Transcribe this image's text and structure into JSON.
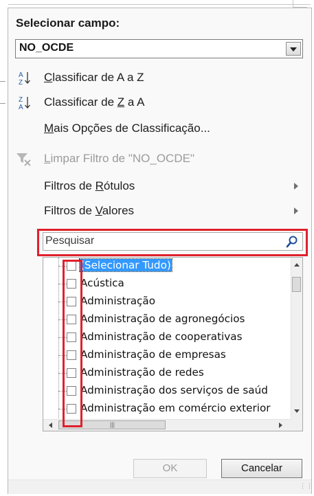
{
  "field_selector": {
    "label": "Selecionar campo:",
    "value": "NO_OCDE"
  },
  "menu": {
    "sort_asc": {
      "pre": "",
      "ul": "C",
      "post": "lassificar de A a Z"
    },
    "sort_desc": {
      "pre": "Classificar de ",
      "ul": "Z",
      "post": " a A"
    },
    "more_sort": {
      "pre": "",
      "ul": "M",
      "post": "ais Opções de Classificação..."
    },
    "clear_filter": {
      "pre": "",
      "ul": "L",
      "post": "impar Filtro de \"NO_OCDE\""
    },
    "label_filters": {
      "pre": "Filtros de ",
      "ul": "R",
      "post": "ótulos"
    },
    "value_filters": {
      "pre": "Filtros de ",
      "ul": "V",
      "post": "alores"
    }
  },
  "search": {
    "placeholder": "Pesquisar"
  },
  "list": {
    "items": [
      {
        "label": "(Selecionar Tudo)",
        "checked": false,
        "selected": true
      },
      {
        "label": "Acústica",
        "checked": false
      },
      {
        "label": "Administração",
        "checked": false
      },
      {
        "label": "Administração de agronegócios",
        "checked": false
      },
      {
        "label": "Administração de cooperativas",
        "checked": false
      },
      {
        "label": "Administração de empresas",
        "checked": false
      },
      {
        "label": "Administração de redes",
        "checked": false
      },
      {
        "label": "Administração dos serviços de saúd",
        "checked": false
      },
      {
        "label": "Administração em comércio exterior",
        "checked": false
      }
    ]
  },
  "buttons": {
    "ok": "OK",
    "cancel": "Cancelar"
  },
  "colors": {
    "highlight_box": "#e0202c",
    "selection": "#3399ff"
  }
}
